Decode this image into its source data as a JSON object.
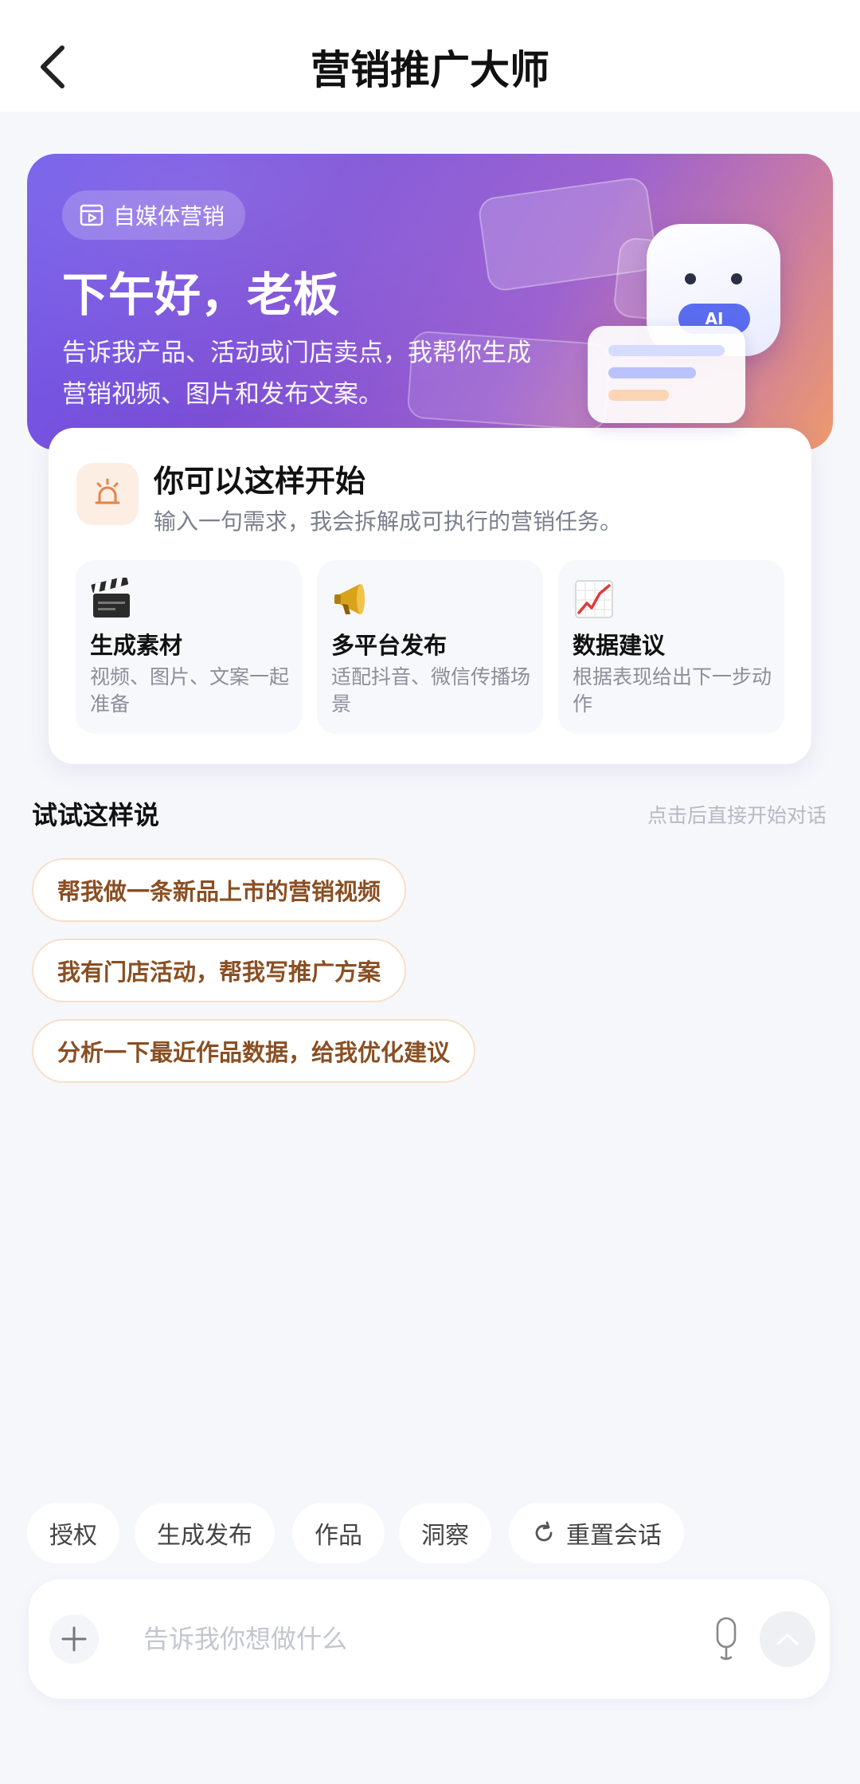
{
  "header": {
    "title": "营销推广大师",
    "back_icon": "chevron-left-icon"
  },
  "hero": {
    "badge": "自媒体营销",
    "badge_icon": "video-frame-icon",
    "greeting": "下午好，老板",
    "description": "告诉我产品、活动或门店卖点，我帮你生成营销视频、图片和发布文案。",
    "mascot_label": "AI",
    "colors": {
      "gradient_start": "#6f58ea",
      "gradient_end": "#ee9a6c"
    }
  },
  "start": {
    "title": "你可以这样开始",
    "subtitle": "输入一句需求，我会拆解成可执行的营销任务。",
    "icon": "alarm-bell-icon",
    "features": [
      {
        "icon": "clapper-board-icon",
        "title": "生成素材",
        "desc": "视频、图片、文案一起准备"
      },
      {
        "icon": "megaphone-icon",
        "title": "多平台发布",
        "desc": "适配抖音、微信传播场景"
      },
      {
        "icon": "trend-chart-icon",
        "title": "数据建议",
        "desc": "根据表现给出下一步动作"
      }
    ]
  },
  "suggestions": {
    "title": "试试这样说",
    "hint": "点击后直接开始对话",
    "items": [
      "帮我做一条新品上市的营销视频",
      "我有门店活动，帮我写推广方案",
      "分析一下最近作品数据，给我优化建议"
    ]
  },
  "quick_actions": [
    "授权",
    "生成发布",
    "作品",
    "洞察",
    "重置会话"
  ],
  "composer": {
    "placeholder": "告诉我你想做什么",
    "value": "",
    "plus_icon": "plus-icon",
    "mic_icon": "microphone-icon",
    "send_icon": "send-arrow-icon"
  }
}
